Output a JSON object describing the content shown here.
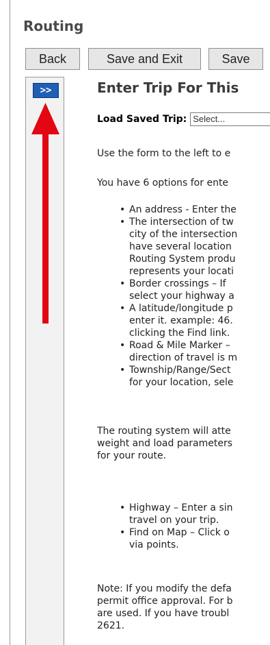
{
  "header": {
    "title": "Routing"
  },
  "toolbar": {
    "back_label": "Back",
    "save_exit_label": "Save and Exit",
    "save_label": "Save"
  },
  "sidebar": {
    "expand_label": ">>"
  },
  "main": {
    "title": "Enter Trip For This",
    "load_label": "Load Saved Trip:",
    "load_select_value": "Select...",
    "intro": "Use the form to the left to e",
    "options_intro": "You have 6 options for ente",
    "bullets": [
      [
        "An address - Enter the"
      ],
      [
        "The intersection of tw",
        "city of the intersection",
        "have several location",
        "Routing System produ",
        "represents your locati"
      ],
      [
        "Border crossings – If",
        "select your highway a"
      ],
      [
        "A latitude/longitude p",
        "enter it. example: 46.",
        "clicking the Find link."
      ],
      [
        "Road & Mile Marker –",
        "direction of travel is m"
      ],
      [
        "Township/Range/Sect",
        "for your location, sele"
      ]
    ],
    "routing_para": [
      "The routing system will atte",
      "weight and load parameters",
      "for your route."
    ],
    "bullets2": [
      [
        "Highway – Enter a sin",
        "travel on your trip."
      ],
      [
        "Find on Map – Click o",
        "via points."
      ]
    ],
    "note": [
      "Note: If you modify the defa",
      "permit office approval. For b",
      "are used. If you have troubl",
      "2621."
    ]
  },
  "colors": {
    "expand_button": "#1f5fb5",
    "arrow": "#e30613",
    "title": "#4a4a4a"
  }
}
